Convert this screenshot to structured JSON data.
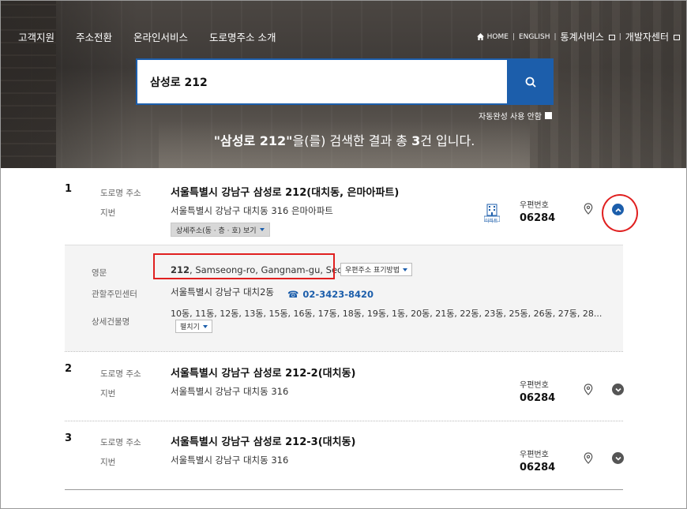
{
  "topnav": [
    "고객지원",
    "주소전환",
    "온라인서비스",
    "도로명주소 소개"
  ],
  "util": {
    "home": "HOME",
    "english": "ENGLISH",
    "stats": "통계서비스",
    "dev": "개발자센터"
  },
  "search": {
    "query": "삼성로 212",
    "autocomplete_label": "자동완성 사용 안함"
  },
  "summary": {
    "query": "\"삼성로 212\"",
    "prefix": "을(를) 검색한 결과 총 ",
    "count": "3",
    "suffix": "건 입니다."
  },
  "labels": {
    "road": "도로명 주소",
    "jibun": "지번",
    "zip": "우편번호",
    "detail_btn": "상세주소(동 · 층 · 호) 보기",
    "eng": "영문",
    "center": "관할주민센터",
    "buildings": "상세건물명",
    "zip_format_btn": "우편주소 표기방법",
    "expand_btn": "펼치기"
  },
  "results": [
    {
      "num": "1",
      "road": "서울특별시 강남구 삼성로 212(대치동, 은마아파트)",
      "jibun": "서울특별시 강남구 대치동 316 은마아파트",
      "zip": "06284",
      "apt_label": "아파트",
      "english_num": "212",
      "english_rest": ", Samseong-ro, Gangnam-gu, Seoul",
      "center": "서울특별시 강남구 대치2동",
      "phone": "02-3423-8420",
      "buildings": "10동, 11동, 12동, 13동, 15동, 16동, 17동, 18동, 19동, 1동, 20동, 21동, 22동, 23동, 25동, 26동, 27동, 28..."
    },
    {
      "num": "2",
      "road": "서울특별시 강남구 삼성로 212-2(대치동)",
      "jibun": "서울특별시 강남구 대치동 316",
      "zip": "06284"
    },
    {
      "num": "3",
      "road": "서울특별시 강남구 삼성로 212-3(대치동)",
      "jibun": "서울특별시 강남구 대치동 316",
      "zip": "06284"
    }
  ],
  "colors": {
    "brand_blue": "#1c5eab",
    "highlight_red": "#e02020"
  }
}
